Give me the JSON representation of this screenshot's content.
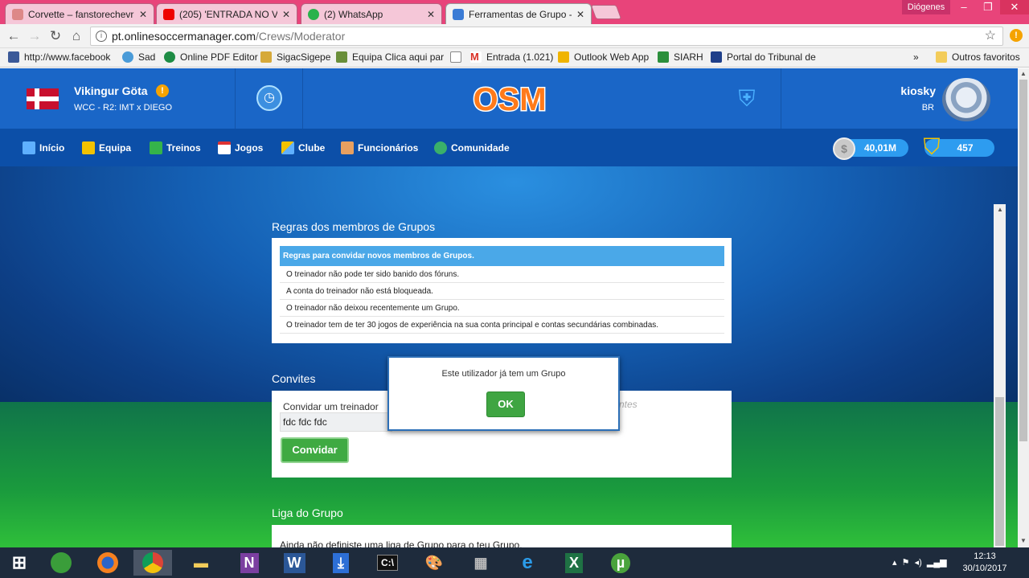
{
  "browser": {
    "tabs": [
      {
        "label": "Corvette – fanstorechevr",
        "close": "✕"
      },
      {
        "label": "(205) 'ENTRADA NO V",
        "close": "✕"
      },
      {
        "label": "(2) WhatsApp",
        "close": "✕"
      },
      {
        "label": "Ferramentas de Grupo - C",
        "close": "✕"
      }
    ],
    "window_user": "Diógenes",
    "url_host": "pt.onlinesoccermanager.com",
    "url_path": "/Crews/Moderator",
    "alert_badge": "!",
    "bookmarks": [
      {
        "label": "http://www.facebook",
        "icon": "facebook-icon"
      },
      {
        "label": "Sad",
        "icon": "sad-icon"
      },
      {
        "label": "Online PDF Editor",
        "icon": "pdf-editor-icon"
      },
      {
        "label": "SigacSigepe",
        "icon": "sigac-icon"
      },
      {
        "label": "Equipa Clica aqui par",
        "icon": "equipa-icon"
      },
      {
        "label": "",
        "icon": "page-icon"
      },
      {
        "label": "Entrada (1.021)",
        "icon": "gmail-icon"
      },
      {
        "label": "Outlook Web App",
        "icon": "outlook-icon"
      },
      {
        "label": "SIARH",
        "icon": "siarh-icon"
      },
      {
        "label": "Portal do Tribunal de",
        "icon": "tcu-icon"
      }
    ],
    "bookmarks_overflow": "»",
    "other_bookmarks": "Outros favoritos"
  },
  "header": {
    "team_name": "Vikingur Göta",
    "team_warning": "!",
    "match": "WCC - R2: IMT x DIEGO",
    "logo": "OSM",
    "username": "kiosky",
    "country": "BR"
  },
  "nav": {
    "items": [
      {
        "label": "Início",
        "icon": "home-icon"
      },
      {
        "label": "Equipa",
        "icon": "shirt-icon"
      },
      {
        "label": "Treinos",
        "icon": "training-icon"
      },
      {
        "label": "Jogos",
        "icon": "calendar-icon"
      },
      {
        "label": "Clube",
        "icon": "club-icon"
      },
      {
        "label": "Funcionários",
        "icon": "staff-icon"
      },
      {
        "label": "Comunidade",
        "icon": "globe-icon"
      }
    ],
    "coins": "40,01M",
    "coin_symbol": "$",
    "gems": "457"
  },
  "rules_section": {
    "title": "Regras dos membros de Grupos",
    "table_header": "Regras para convidar novos membros de Grupos.",
    "rows": [
      "O treinador não pode ter sido banido dos fóruns.",
      "A conta do treinador não está bloqueada.",
      "O treinador não deixou recentemente um Grupo.",
      "O treinador tem de ter 30 jogos de experiência na sua conta principal e contas secundárias combinadas."
    ]
  },
  "invites": {
    "title": "Convites",
    "label": "Convidar um treinador",
    "input_value": "fdc fdc fdc",
    "button": "Convidar",
    "ghost_text": "ntes"
  },
  "league": {
    "title": "Liga do Grupo",
    "text": "Ainda não definiste uma liga de Grupo para o teu Grupo."
  },
  "modal": {
    "message": "Este utilizador já tem um Grupo",
    "ok": "OK"
  },
  "taskbar": {
    "time": "12:13",
    "date": "30/10/2017"
  },
  "colors": {
    "osm_blue": "#1a66c7",
    "nav_blue": "#0c4fa8",
    "button_green": "#3fa542",
    "rules_header": "#4aa8e8",
    "chrome_tabstrip": "#e8447a"
  }
}
